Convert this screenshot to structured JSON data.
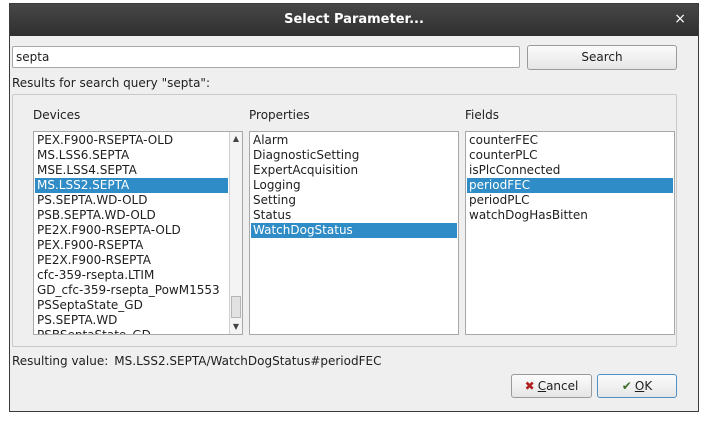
{
  "dialog": {
    "title": "Select Parameter...",
    "close_glyph": "×"
  },
  "search": {
    "value": "septa",
    "button_label": "Search"
  },
  "results_label": "Results for search query \"septa\":",
  "columns": {
    "devices_label": "Devices",
    "properties_label": "Properties",
    "fields_label": "Fields"
  },
  "devices": {
    "items": [
      "PEX.F900-RSEPTA-OLD",
      "MS.LSS6.SEPTA",
      "MSE.LSS4.SEPTA",
      "MS.LSS2.SEPTA",
      "PS.SEPTA.WD-OLD",
      "PSB.SEPTA.WD-OLD",
      "PE2X.F900-RSEPTA-OLD",
      "PEX.F900-RSEPTA",
      "PE2X.F900-RSEPTA",
      "cfc-359-rsepta.LTIM",
      "GD_cfc-359-rsepta_PowM1553",
      "PSSeptaState_GD",
      "PS.SEPTA.WD",
      "PSBSeptaState_GD"
    ],
    "selected": "MS.LSS2.SEPTA",
    "scroll_up_icon": "▲",
    "scroll_down_icon": "▼"
  },
  "properties": {
    "items": [
      "Alarm",
      "DiagnosticSetting",
      "ExpertAcquisition",
      "Logging",
      "Setting",
      "Status",
      "WatchDogStatus"
    ],
    "selected": "WatchDogStatus"
  },
  "fields": {
    "items": [
      "counterFEC",
      "counterPLC",
      "isPlcConnected",
      "periodFEC",
      "periodPLC",
      "watchDogHasBitten"
    ],
    "selected": "periodFEC"
  },
  "resulting": {
    "label": "Resulting value:",
    "value": "MS.LSS2.SEPTA/WatchDogStatus#periodFEC"
  },
  "buttons": {
    "cancel_icon": "cancel-x-icon",
    "cancel_mnemonic": "C",
    "cancel_rest": "ancel",
    "ok_icon": "checkmark-icon",
    "ok_mnemonic": "O",
    "ok_rest": "K"
  }
}
